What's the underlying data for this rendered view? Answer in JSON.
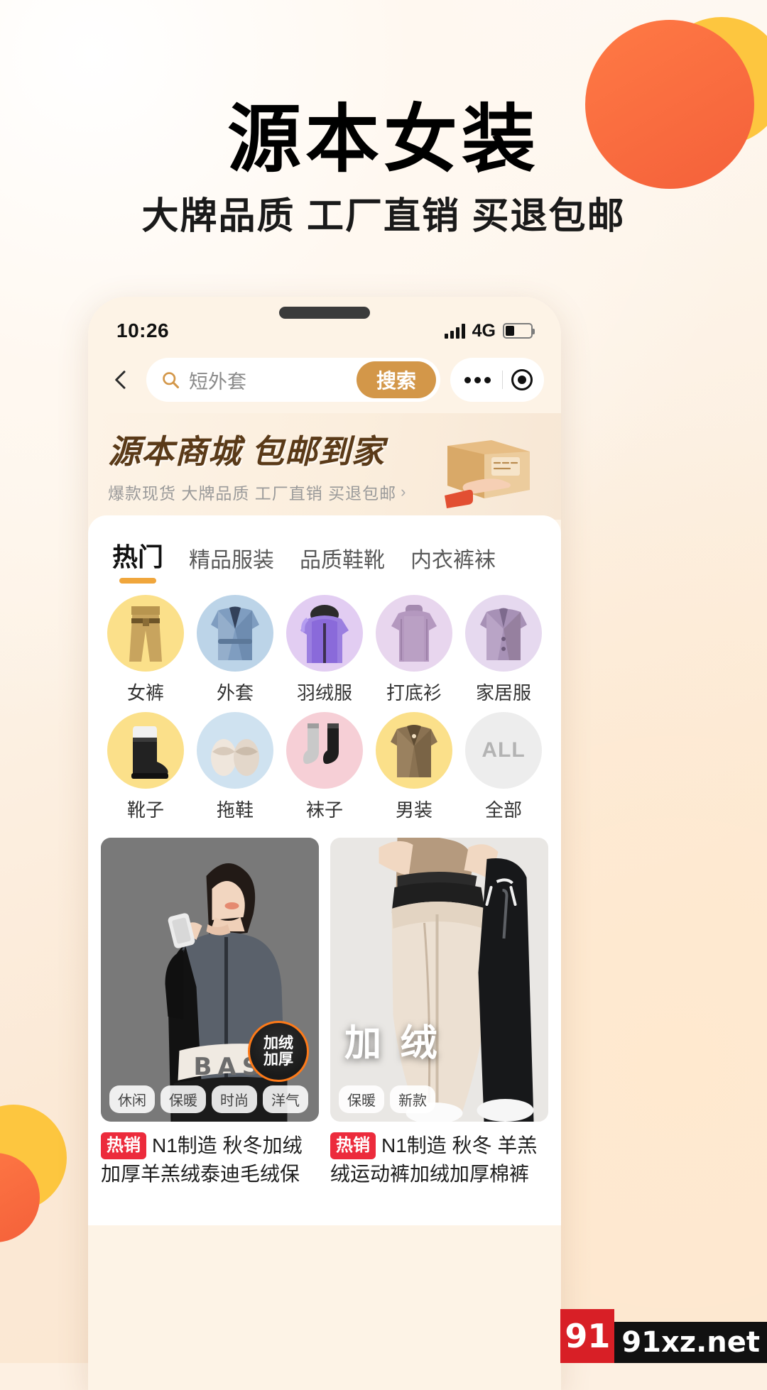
{
  "promo": {
    "title": "源本女装",
    "subtitle": "大牌品质  工厂直销  买退包邮",
    "colors": {
      "orange": "#f4603a",
      "yellow": "#fdc63f",
      "bg": "#fdf0e2"
    }
  },
  "status_bar": {
    "time": "10:26",
    "network": "4G",
    "signal_icon": "signal-bars-icon",
    "battery_icon": "battery-icon"
  },
  "search": {
    "back_icon": "chevron-left-icon",
    "search_icon": "search-icon",
    "value": "短外套",
    "placeholder": "短外套",
    "submit_label": "搜索",
    "more_icon": "more-dots-icon",
    "target_icon": "target-icon"
  },
  "banner": {
    "title": "源本商城 包邮到家",
    "sub": "爆款现货  大牌品质  工厂直销  买退包邮",
    "arrow": "›",
    "art_icon": "parcel-box-icon",
    "title_color": "#5a3a18"
  },
  "tabs": [
    {
      "label": "热门",
      "active": true
    },
    {
      "label": "精品服装",
      "active": false
    },
    {
      "label": "品质鞋靴",
      "active": false
    },
    {
      "label": "内衣裤袜",
      "active": false
    }
  ],
  "tab_accent": "#f0a63c",
  "categories": [
    {
      "label": "女裤",
      "icon": "trousers-icon",
      "bg": "#fbe08a"
    },
    {
      "label": "外套",
      "icon": "coat-icon",
      "bg": "#bcd4e8"
    },
    {
      "label": "羽绒服",
      "icon": "down-jacket-icon",
      "bg": "#e2cdf2"
    },
    {
      "label": "打底衫",
      "icon": "sweater-icon",
      "bg": "#e8d6ee"
    },
    {
      "label": "家居服",
      "icon": "homewear-icon",
      "bg": "#e6d9ef"
    },
    {
      "label": "靴子",
      "icon": "boots-icon",
      "bg": "#fbe08a"
    },
    {
      "label": "拖鞋",
      "icon": "slippers-icon",
      "bg": "#cfe2f0"
    },
    {
      "label": "袜子",
      "icon": "socks-icon",
      "bg": "#f6cfd6"
    },
    {
      "label": "男装",
      "icon": "menswear-icon",
      "bg": "#fbe08a"
    },
    {
      "label": "全部",
      "icon": "all-icon",
      "bg": "#ededed",
      "art_text": "ALL"
    }
  ],
  "products": [
    {
      "badge": "热销",
      "title": "N1制造 秋冬加绒加厚羊羔绒泰迪毛绒保",
      "tags": [
        "休闲",
        "保暖",
        "时尚",
        "洋气"
      ],
      "fire_badge_lines": [
        "加绒",
        "加厚"
      ],
      "overlay_word": ""
    },
    {
      "badge": "热销",
      "title": "N1制造 秋冬 羊羔绒运动裤加绒加厚棉裤",
      "tags": [
        "保暖",
        "新款"
      ],
      "fire_badge_lines": [],
      "overlay_word": "加 绒"
    }
  ],
  "watermark": {
    "logo": "91",
    "text": "91xz.net"
  }
}
